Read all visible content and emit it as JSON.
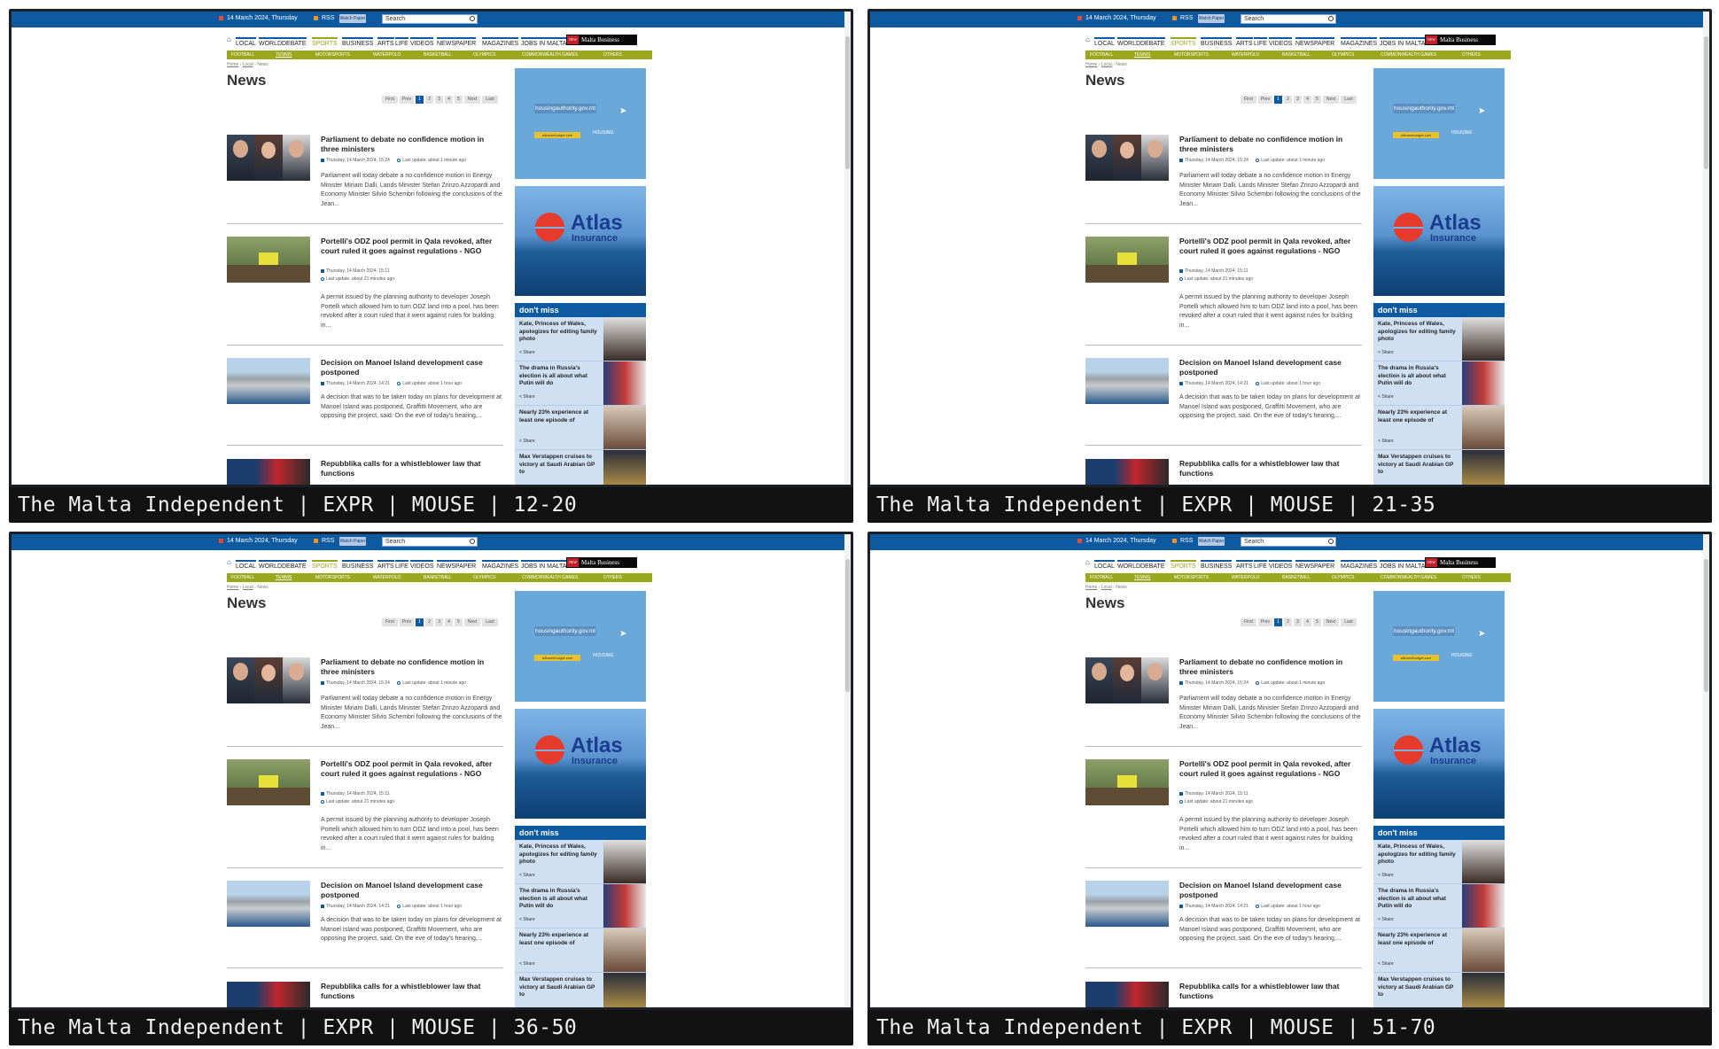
{
  "site": {
    "date": "14 March 2024, Thursday",
    "rss": "RSS",
    "epaper": "Watch Paper",
    "search_placeholder": "Search",
    "nav": [
      "LOCAL",
      "WORLD",
      "DEBATE",
      "SPORTS",
      "BUSINESS",
      "ARTS",
      "LIFE",
      "VIDEOS",
      "NEWSPAPER",
      "MAGAZINES",
      "JOBS IN MALTA"
    ],
    "mbw_new": "NEW",
    "mbw": "Malta Business Weekly",
    "subnav": [
      "FOOTBALL",
      "TENNIS",
      "MOTORSPORTS",
      "WATERPOLO",
      "BASKETBALL",
      "OLYMPICS",
      "COMMONWEALTH GAMES",
      "OTHERS"
    ],
    "breadcrumb": [
      "Home",
      "Local",
      "News"
    ],
    "page_title": "News",
    "pager": [
      "First",
      "Prev",
      "1",
      "2",
      "3",
      "4",
      "5",
      "Next",
      "Last"
    ],
    "articles": [
      {
        "title": "Parliament to debate no confidence motion in three ministers",
        "date": "Thursday, 14 March 2024, 15:24",
        "update": "Last update: about 1 minute ago",
        "excerpt": "Parliament will today debate a no confidence motion in Energy Minister Miriam Dalli, Lands Minister Stefan Zrinzo Azzopardi and Economy Minister Silvio Schembri following the conclusions of the Jean..."
      },
      {
        "title": "Portelli's ODZ pool permit in Qala revoked, after court ruled it goes against regulations - NGO",
        "date": "Thursday, 14 March 2024, 15:11",
        "update": "Last update: about 21 minutes ago",
        "excerpt": "A permit issued by the planning authority to developer Joseph Portelli which allowed him to turn ODZ land into a pool, has been revoked after a court ruled that it went against rules for building in..."
      },
      {
        "title": "Decision on Manoel Island development case postponed",
        "date": "Thursday, 14 March 2024, 14:21",
        "update": "Last update: about 1 hour ago",
        "excerpt": "A decision that was to be taken today on plans for development at Manoel Island was postponed, Graffitti Movement, who are opposing the project, said. On the eve of today's hearing,..."
      },
      {
        "title": "Repubblika calls for a whistleblower law that functions"
      }
    ],
    "ad_housing": {
      "url": "housingauthority.gov.mt",
      "tag": "allinonebudget.com",
      "logo": "HOUSING"
    },
    "ad_atlas": {
      "brand": "Atlas",
      "sub": "Insurance"
    },
    "dont_miss": {
      "heading": "don't miss",
      "share": "Share",
      "items": [
        "Kate, Princess of Wales, apologizes for editing family photo",
        "The drama in Russia's election is all about what Putin will do",
        "Nearly 23% experience at least one episode of",
        "Max Verstappen cruises to victory at Saudi Arabian GP to"
      ]
    }
  },
  "panels": [
    {
      "caption": "The Malta Independent | EXPR | MOUSE | 12-20"
    },
    {
      "caption": "The Malta Independent | EXPR | MOUSE | 21-35"
    },
    {
      "caption": "The Malta Independent | EXPR | MOUSE | 36-50"
    },
    {
      "caption": "The Malta Independent | EXPR | MOUSE | 51-70"
    }
  ],
  "colors": {
    "brand_blue": "#0d5aa0",
    "sports_olive": "#9aa81e",
    "dontmiss_bg": "#cfe0f3"
  }
}
